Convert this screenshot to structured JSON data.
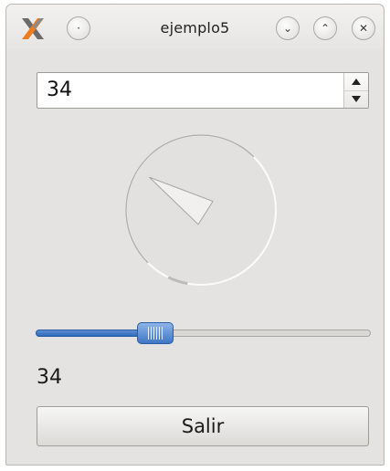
{
  "window": {
    "title": "ejemplo5",
    "buttons": {
      "menu": "·",
      "minimize": "⌄",
      "maximize": "⌃",
      "close": "✕"
    }
  },
  "spinbox": {
    "value": "34"
  },
  "dial": {
    "value": 34
  },
  "slider": {
    "value": 34,
    "min": 0,
    "max": 100
  },
  "label": {
    "value": "34"
  },
  "quit_button": {
    "label": "Salir"
  },
  "colors": {
    "accent": "#3a72c4",
    "window_bg": "#e4e3e1"
  }
}
